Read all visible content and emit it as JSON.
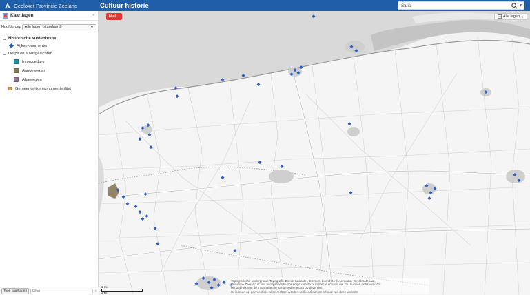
{
  "header": {
    "brand": "Geoloket Provincie Zeeland",
    "app_title": "Cultuur historie",
    "search_value": "Sluis",
    "colors": {
      "bar": "#1f5fa9",
      "accent_red": "#e53935",
      "point_blue": "#2a5fc7"
    },
    "icons": {
      "logo": "province-logo-icon",
      "search": "search-icon",
      "caret": "chevron-down-icon"
    }
  },
  "sidebar": {
    "panel_title": "Kaartlagen",
    "close": "×",
    "group_label": "Hoofdgroep",
    "group_value": "Alle lagen (standaard)",
    "tree": [
      {
        "label": "Historische stedenbouw",
        "icon": "checkbox-icon"
      },
      {
        "label": "Rijksmonumenten",
        "icon": "diamond-marker-icon"
      },
      {
        "label": "Dorps en stadsgezichten",
        "icon": "checkbox-icon"
      },
      {
        "label": "In procedure",
        "icon": "swatch-teal-icon"
      },
      {
        "label": "Aangewezen",
        "icon": "swatch-brown-icon"
      },
      {
        "label": "Afgewezen",
        "icon": "swatch-mauve-icon"
      },
      {
        "label": "Gemeentelijke monumentenlijst",
        "icon": "swatch-orange-icon"
      }
    ],
    "toon_label": "Toon kaartlagen",
    "filter_placeholder": "Filter",
    "filter_clear": "×"
  },
  "map": {
    "red_button_label": "N el...",
    "layers_button_label": "Alle lagen",
    "scale_top": "1 mi",
    "scale_bottom": "2 km",
    "attribution_lines": [
      "Topografische ondergrond: Topografie Dienst Kadaster, Emmen. Luchtfoto © Aerodata, Beeldmateriaal,",
      "Provincie Zeeland is niet aansprakelijk voor enige directe of indirecte schade die zou kunnen ontstaan door",
      "het gebruik van de informatie die aangeboden wordt op deze site.",
      "Er kunnen op geen enkele wijze rechten worden ontleend aan de inhoud van deze website."
    ]
  }
}
